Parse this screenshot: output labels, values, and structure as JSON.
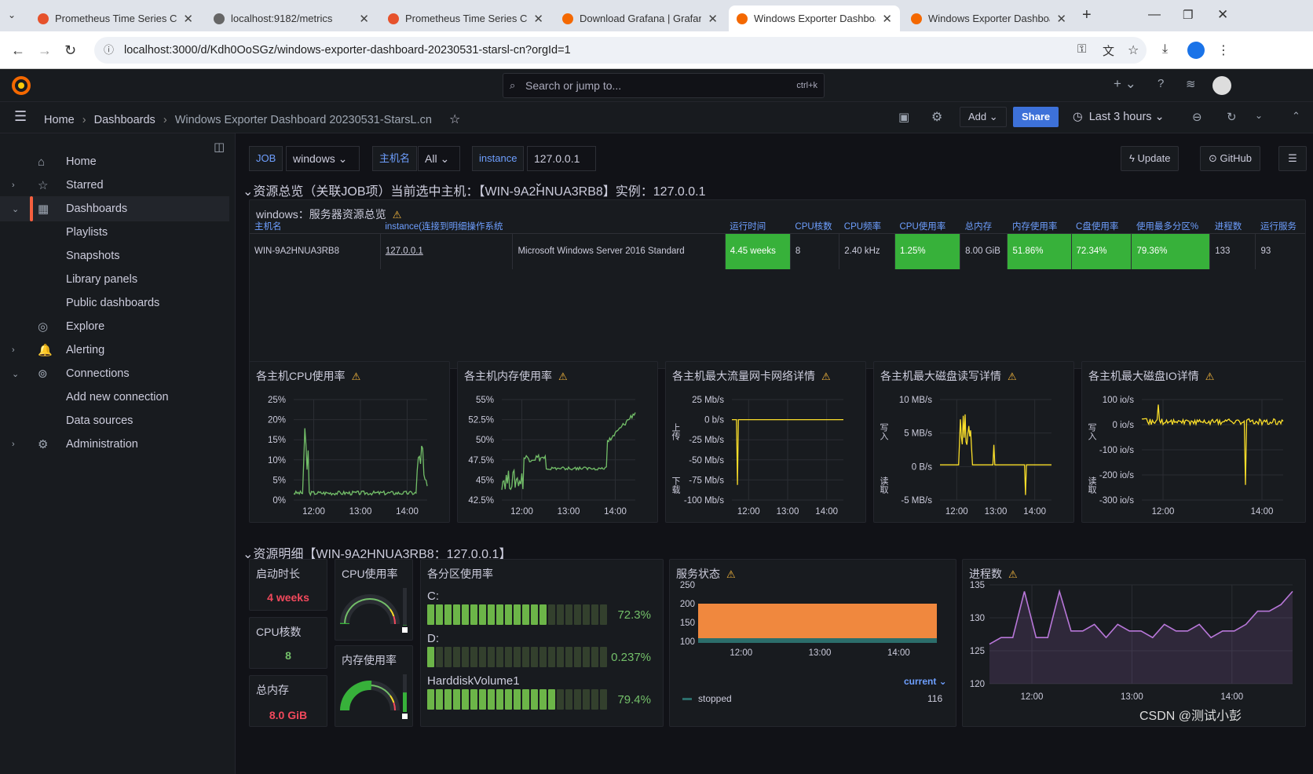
{
  "browser": {
    "tabs": [
      {
        "title": "Prometheus Time Series Coll",
        "color": "#e6522c",
        "active": false
      },
      {
        "title": "localhost:9182/metrics",
        "color": "#666",
        "active": false
      },
      {
        "title": "Prometheus Time Series Coll",
        "color": "#e6522c",
        "active": false
      },
      {
        "title": "Download Grafana | Grafana",
        "color": "#f46800",
        "active": false
      },
      {
        "title": "Windows Exporter Dashboar",
        "color": "#f46800",
        "active": true
      },
      {
        "title": "Windows Exporter Dashboar",
        "color": "#f46800",
        "active": false
      }
    ],
    "url": "localhost:3000/d/Kdh0OoSGz/windows-exporter-dashboard-20230531-starsl-cn?orgId=1"
  },
  "grafana": {
    "search_placeholder": "Search or jump to...",
    "search_shortcut": "ctrl+k",
    "breadcrumb": [
      "Home",
      "Dashboards",
      "Windows Exporter Dashboard 20230531-StarsL.cn"
    ],
    "add_label": "Add",
    "share_label": "Share",
    "time_range": "Last 3 hours"
  },
  "sidebar": {
    "items": [
      {
        "label": "Home",
        "icon": "⌂",
        "chev": ""
      },
      {
        "label": "Starred",
        "icon": "☆",
        "chev": "›"
      },
      {
        "label": "Dashboards",
        "icon": "▦",
        "chev": "⌄",
        "selected": true
      },
      {
        "label": "Playlists",
        "sub": true
      },
      {
        "label": "Snapshots",
        "sub": true
      },
      {
        "label": "Library panels",
        "sub": true
      },
      {
        "label": "Public dashboards",
        "sub": true
      },
      {
        "label": "Explore",
        "icon": "◎",
        "chev": ""
      },
      {
        "label": "Alerting",
        "icon": "🔔",
        "chev": "›"
      },
      {
        "label": "Connections",
        "icon": "⊚",
        "chev": "⌄"
      },
      {
        "label": "Add new connection",
        "sub": true
      },
      {
        "label": "Data sources",
        "sub": true
      },
      {
        "label": "Administration",
        "icon": "⚙",
        "chev": "›"
      }
    ]
  },
  "vars": {
    "job_label": "JOB",
    "job_value": "windows",
    "host_label": "主机名",
    "host_value": "All",
    "inst_label": "instance",
    "inst_value": "127.0.0.1"
  },
  "buttons": {
    "update": "Update",
    "github": "GitHub"
  },
  "rows": {
    "overview": "资源总览（关联JOB项）当前选中主机：【WIN-9A2HNUA3RB8】实例：127.0.0.1",
    "detail": "资源明细【WIN-9A2HNUA3RB8：127.0.0.1】"
  },
  "table": {
    "title": "windows：服务器资源总览",
    "headers": [
      "主机名",
      "instance(连接到明细操作系统",
      "",
      "运行时间",
      "CPU核数",
      "CPU频率",
      "CPU使用率",
      "总内存",
      "内存使用率",
      "C盘使用率",
      "使用最多分区%",
      "进程数",
      "运行服务"
    ],
    "row": [
      "WIN-9A2HNUA3RB8",
      "127.0.0.1",
      "Microsoft Windows Server 2016 Standard",
      "4.45 weeks",
      "8",
      "2.40 kHz",
      "1.25%",
      "8.00 GiB",
      "51.86%",
      "72.34%",
      "79.36%",
      "133",
      "93"
    ]
  },
  "charts": [
    {
      "title": "各主机CPU使用率",
      "yticks": [
        "25%",
        "20%",
        "15%",
        "10%",
        "5%",
        "0%"
      ],
      "xticks": [
        "12:00",
        "13:00",
        "14:00"
      ]
    },
    {
      "title": "各主机内存使用率",
      "yticks": [
        "55%",
        "52.5%",
        "50%",
        "47.5%",
        "45%",
        "42.5%"
      ],
      "xticks": [
        "12:00",
        "13:00",
        "14:00"
      ]
    },
    {
      "title": "各主机最大流量网卡网络详情",
      "yticks": [
        "25 Mb/s",
        "0 b/s",
        "-25 Mb/s",
        "-50 Mb/s",
        "-75 Mb/s",
        "-100 Mb/s"
      ],
      "xticks": [
        "12:00",
        "13:00",
        "14:00"
      ],
      "ylabel_top": "上传",
      "ylabel_bottom": "下载"
    },
    {
      "title": "各主机最大磁盘读写详情",
      "yticks": [
        "10 MB/s",
        "5 MB/s",
        "0 B/s",
        "-5 MB/s"
      ],
      "xticks": [
        "12:00",
        "13:00",
        "14:00"
      ],
      "ylabel_top": "写入",
      "ylabel_bottom": "读取"
    },
    {
      "title": "各主机最大磁盘IO详情",
      "yticks": [
        "100 io/s",
        "0 io/s",
        "-100 io/s",
        "-200 io/s",
        "-300 io/s"
      ],
      "xticks": [
        "12:00",
        "14:00"
      ],
      "ylabel_top": "写入",
      "ylabel_bottom": "读取"
    }
  ],
  "stats": {
    "uptime": {
      "title": "启动时长",
      "value": "4 weeks"
    },
    "cores": {
      "title": "CPU核数",
      "value": "8"
    },
    "mem": {
      "title": "总内存",
      "value": "8.0 GiB"
    },
    "cpu_gauge": {
      "title": "CPU使用率",
      "value": 0.0125
    },
    "mem_gauge": {
      "title": "内存使用率",
      "value": 0.5186
    }
  },
  "partitions": {
    "title": "各分区使用率",
    "items": [
      {
        "name": "C:",
        "pct": "72.3%",
        "value": 0.723
      },
      {
        "name": "D:",
        "pct": "0.237%",
        "value": 0.00237
      },
      {
        "name": "HarddiskVolume1",
        "pct": "79.4%",
        "value": 0.794
      }
    ]
  },
  "services": {
    "title": "服务状态",
    "yticks": [
      "250",
      "200",
      "150",
      "100"
    ],
    "xticks": [
      "12:00",
      "13:00",
      "14:00"
    ],
    "legend_header": "current",
    "legend_name": "stopped",
    "legend_value": "116"
  },
  "process": {
    "title": "进程数",
    "yticks": [
      "135",
      "130",
      "125",
      "120"
    ],
    "xticks": [
      "12:00",
      "13:00",
      "14:00"
    ]
  },
  "watermark": "CSDN @测试小彭"
}
